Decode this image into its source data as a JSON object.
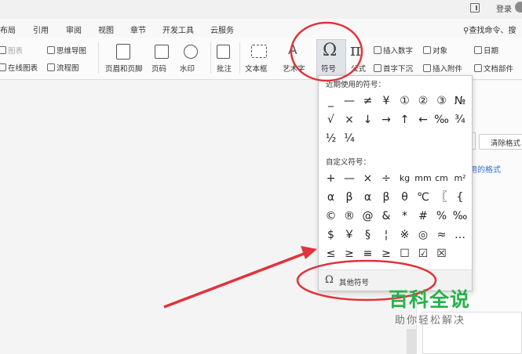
{
  "titlebar": {
    "login": "登录"
  },
  "menu": [
    {
      "label": "布局"
    },
    {
      "label": "引用"
    },
    {
      "label": "审阅"
    },
    {
      "label": "视图"
    },
    {
      "label": "章节"
    },
    {
      "label": "开发工具"
    },
    {
      "label": "云服务"
    }
  ],
  "search": {
    "label": "查找命令、搜"
  },
  "ribbon": {
    "chart": "图表",
    "mindmap": "思维导图",
    "online_chart": "在线图表",
    "flowchart": "流程图",
    "header_footer": "页眉和页脚",
    "page_number": "页码",
    "watermark": "水印",
    "comment": "批注",
    "textbox": "文本框",
    "wordart": "艺术字",
    "symbol": "符号",
    "formula": "公式",
    "insert_number": "插入数字",
    "object": "对象",
    "dropcap": "首字下沉",
    "attachment": "插入附件",
    "date": "日期",
    "doc_parts": "文档部件"
  },
  "icons": {
    "symbol": "omega-icon",
    "formula": "pi-icon",
    "textbox": "textbox-icon",
    "wordart": "wordart-icon",
    "header_footer": "header-footer-icon",
    "page_number": "page-number-icon",
    "watermark": "watermark-icon",
    "comment": "comment-icon"
  },
  "symbol_popup": {
    "recent_title": "近期使用的符号：",
    "recent": [
      "_",
      "—",
      "≠",
      "¥",
      "①",
      "②",
      "③",
      "№",
      "√",
      "×",
      "↓",
      "→",
      "↑",
      "←",
      "‰",
      "¾",
      "½",
      "¼"
    ],
    "custom_title": "自定义符号：",
    "custom": [
      "+",
      "—",
      "×",
      "÷",
      "kg",
      "mm",
      "cm",
      "m²",
      "α",
      "β",
      "α",
      "β",
      "θ",
      "℃",
      "〖",
      "{",
      "©",
      "®",
      "@",
      "&",
      "*",
      "#",
      "%",
      "‰",
      "$",
      "￥",
      "§",
      "¦",
      "※",
      "◎",
      "≈",
      "…",
      "≤",
      "≥",
      "≡",
      "≥",
      "☐",
      "☑",
      "☒"
    ],
    "more": "其他符号"
  },
  "panel": {
    "clear_format": "清除格式",
    "used_format": "用的格式"
  },
  "watermark": {
    "title": "百科全说",
    "subtitle": "助你轻松解决"
  },
  "colors": {
    "annotation_red": "#e0333a",
    "link_blue": "#2e6fd6",
    "watermark_green": "#27b24a"
  }
}
